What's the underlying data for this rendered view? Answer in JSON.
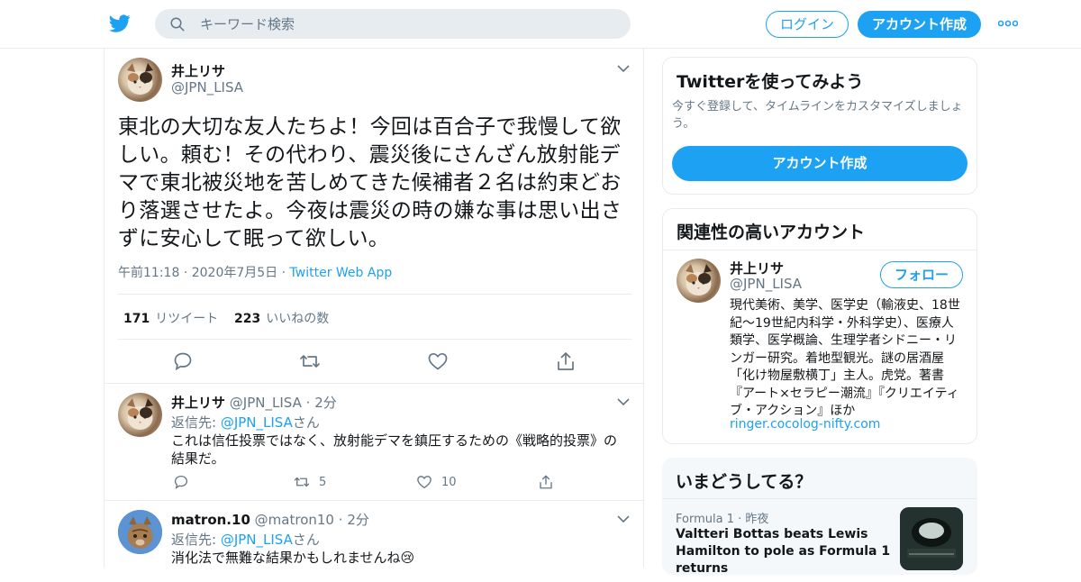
{
  "header": {
    "search_placeholder": "キーワード検索",
    "login_label": "ログイン",
    "signup_label": "アカウント作成"
  },
  "main_tweet": {
    "author_name": "井上リサ",
    "author_handle": "@JPN_LISA",
    "text": "東北の大切な友人たちよ！今回は百合子で我慢して欲しい。頼む！その代わり、震災後にさんざん放射能デマで東北被災地を苦しめてきた候補者２名は約束どおり落選させたよ。今夜は震災の時の嫌な事は思い出さずに安心して眠って欲しい。",
    "time": "午前11:18",
    "date": "2020年7月5日",
    "via": "Twitter Web App",
    "retweet_count": "171",
    "retweet_label": "リツイート",
    "like_count": "223",
    "like_label": "いいねの数"
  },
  "replies": [
    {
      "author_name": "井上リサ",
      "author_handle": "@JPN_LISA",
      "age": "2分",
      "reply_to_prefix": "返信先: ",
      "reply_to_handle": "@JPN_LISA",
      "reply_to_suffix": "さん",
      "text": "これは信任投票ではなく、放射能デマを鎮圧するための《戦略的投票》の結果だ。",
      "retweets": "5",
      "likes": "10"
    },
    {
      "author_name": "matron.10",
      "author_handle": "@matron10",
      "age": "2分",
      "reply_to_prefix": "返信先: ",
      "reply_to_handle": "@JPN_LISA",
      "reply_to_suffix": "さん",
      "text": "消化法で無難な結果かもしれませんね😢"
    }
  ],
  "signup_card": {
    "title": "Twitterを使ってみよう",
    "subtitle": "今すぐ登録して、タイムラインをカスタマイズしましょう。",
    "button": "アカウント作成"
  },
  "related_card": {
    "title": "関連性の高いアカウント",
    "name": "井上リサ",
    "handle": "@JPN_LISA",
    "follow": "フォロー",
    "bio": "現代美術、美学、医学史（輸液史、18世紀～19世紀内科学・外科学史）、医療人類学、医学概論、生理学者シドニー・リンガー研究。着地型観光。謎の居酒屋「化け物屋敷横丁」主人。虎党。著書『アート×セラピー潮流』『クリエイティブ・アクション』ほか",
    "link": "ringer.cocolog-nifty.com"
  },
  "trends_card": {
    "title": "いまどうしてる？",
    "category": "Formula 1",
    "when": "昨夜",
    "headline": "Valtteri Bottas beats Lewis Hamilton to pole as Formula 1 returns"
  },
  "colors": {
    "accent": "#1da1f2",
    "secondary_text": "#657786",
    "border": "#e6ecf0"
  }
}
